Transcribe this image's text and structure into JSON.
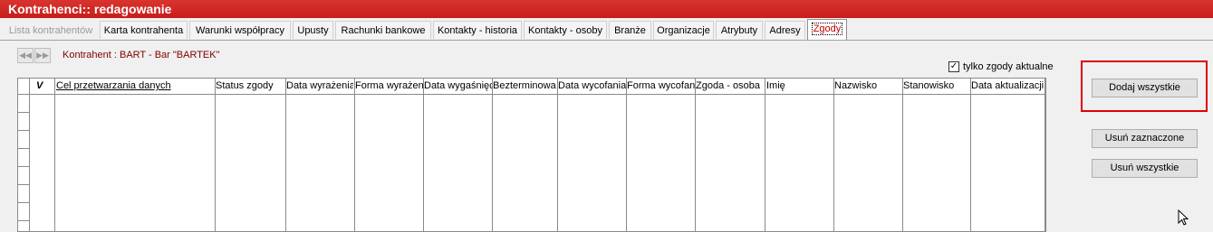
{
  "window": {
    "title": "Kontrahenci:: redagowanie"
  },
  "tabs": [
    {
      "label": "Lista kontrahentów",
      "state": "disabled"
    },
    {
      "label": "Karta kontrahenta"
    },
    {
      "label": "Warunki współpracy"
    },
    {
      "label": "Upusty"
    },
    {
      "label": "Rachunki bankowe"
    },
    {
      "label": "Kontakty - historia"
    },
    {
      "label": "Kontakty - osoby"
    },
    {
      "label": "Branże"
    },
    {
      "label": "Organizacje"
    },
    {
      "label": "Atrybuty"
    },
    {
      "label": "Adresy"
    },
    {
      "label": "Zgody",
      "state": "active"
    }
  ],
  "nav": {
    "prev": "◀◀",
    "next": "▶▶"
  },
  "kontrahent_label": "Kontrahent : BART  -  Bar \"BARTEK\"",
  "filter": {
    "label": "tylko zgody aktualne",
    "checked": true,
    "check_mark": "✓"
  },
  "grid": {
    "check_header": "V",
    "columns": [
      "Cel przetwarzania danych",
      "Status zgody",
      "Data wyrażenia",
      "Forma wyrażenia",
      "Data wygaśnięcia",
      "Bezterminowa",
      "Data wycofania",
      "Forma wycofania",
      "Zgoda - osoba",
      "Imię",
      "Nazwisko",
      "Stanowisko",
      "Data aktualizacji"
    ]
  },
  "buttons": {
    "add_all": "Dodaj wszystkie",
    "remove_selected": "Usuń zaznaczone",
    "remove_all": "Usuń wszystkie"
  },
  "colors": {
    "title_bar": "#d02a26",
    "highlight": "#e00000",
    "kontrahent_text": "#800000"
  },
  "icons": {
    "cursor": "mouse-pointer-icon"
  }
}
